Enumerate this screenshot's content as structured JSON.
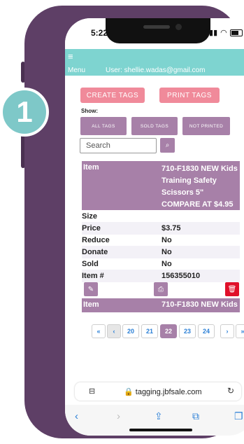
{
  "status": {
    "time": "5:22"
  },
  "header": {
    "menu_label": "Menu",
    "user_text": "User: shellie.wadas@gmail.com",
    "bg_color": "#7ed4d0"
  },
  "actions": {
    "create_tags": "CREATE TAGS",
    "print_tags": "PRINT TAGS"
  },
  "filters": {
    "show_label": "Show:",
    "all_tags": "ALL TAGS",
    "sold_tags": "SOLD TAGS",
    "not_printed": "NOT PRINTED"
  },
  "search": {
    "placeholder": "Search"
  },
  "item": {
    "label": "Item",
    "value": "710-F1830 NEW Kids Training Safety Scissors 5\" COMPARE AT $4.95",
    "rows": [
      {
        "key": "Size",
        "value": ""
      },
      {
        "key": "Price",
        "value": "$3.75"
      },
      {
        "key": "Reduce",
        "value": "No"
      },
      {
        "key": "Donate",
        "value": "No"
      },
      {
        "key": "Sold",
        "value": "No"
      },
      {
        "key": "Item #",
        "value": "156355010"
      }
    ]
  },
  "item2": {
    "label": "Item",
    "value": "710-F1830 NEW Kids"
  },
  "pager": {
    "first": "«",
    "prev": "‹",
    "pages": [
      "20",
      "21",
      "22",
      "23",
      "24"
    ],
    "active": "22",
    "next": "›",
    "last": "»"
  },
  "browser": {
    "url": "tagging.jbfsale.com"
  },
  "step_badge": "1",
  "colors": {
    "accent": "#a780a8",
    "pink": "#f08a9a",
    "delete": "#e0102a",
    "frame": "#5e3f66"
  }
}
